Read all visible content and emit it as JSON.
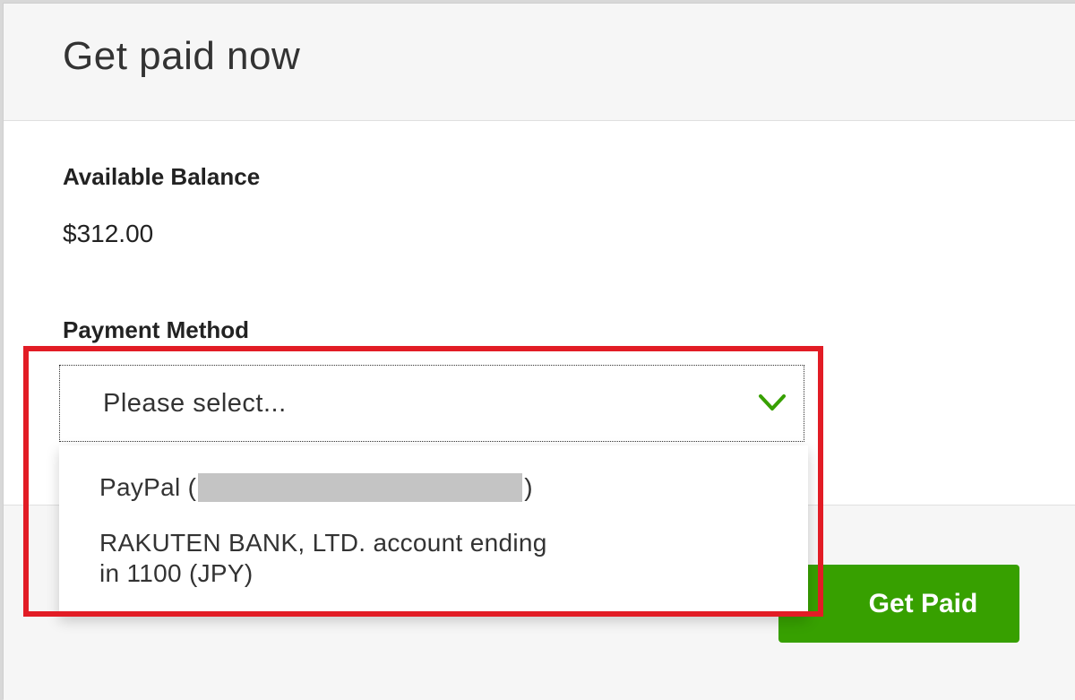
{
  "header": {
    "title": "Get paid now"
  },
  "balance": {
    "label": "Available Balance",
    "value": "$312.00"
  },
  "payment_method": {
    "label": "Payment Method",
    "select_placeholder": "Please select...",
    "options": [
      {
        "prefix": "PayPal (",
        "suffix": ")"
      },
      {
        "label": "RAKUTEN BANK, LTD. account ending in 1100 (JPY)"
      }
    ]
  },
  "footer": {
    "get_paid_label": "Get Paid"
  },
  "icons": {
    "select_chevron": "chevron-down-icon"
  },
  "colors": {
    "accent_green": "#37a000",
    "highlight_red": "#e21c25"
  }
}
